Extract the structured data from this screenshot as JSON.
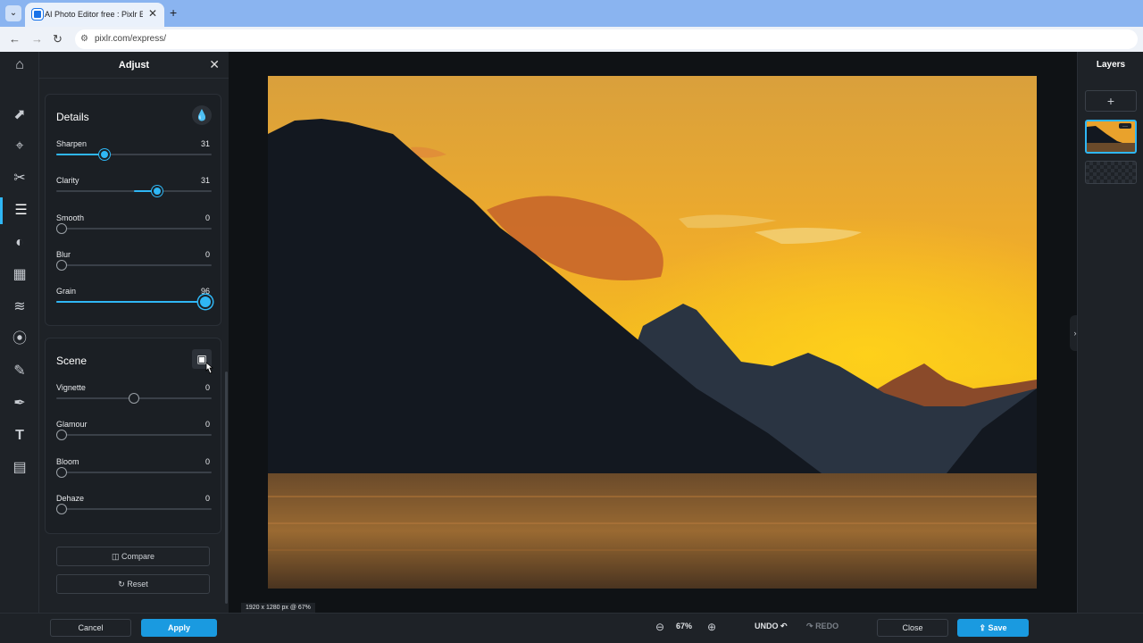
{
  "browser": {
    "tab_title": "AI Photo Editor free : Pixlr Express",
    "new_tab": "+",
    "url": "pixlr.com/express/"
  },
  "rail": {
    "icons": [
      "home-icon",
      "select-icon",
      "crop-icon",
      "cutout-icon",
      "adjust-icon",
      "filter-icon",
      "effect-icon",
      "liquify-icon",
      "swirl-icon",
      "retouch-icon",
      "draw-icon",
      "text-icon",
      "pattern-icon"
    ]
  },
  "panel": {
    "title": "Adjust",
    "details": {
      "title": "Details",
      "sliders": [
        {
          "label": "Sharpen",
          "value": "31",
          "level": 0.31
        },
        {
          "label": "Clarity",
          "value": "31",
          "level": 0.65
        },
        {
          "label": "Smooth",
          "value": "0",
          "level": 0
        },
        {
          "label": "Blur",
          "value": "0",
          "level": 0
        },
        {
          "label": "Grain",
          "value": "96",
          "level": 0.96
        }
      ]
    },
    "scene": {
      "title": "Scene",
      "sliders": [
        {
          "label": "Vignette",
          "value": "0",
          "level": 0.5
        },
        {
          "label": "Glamour",
          "value": "0",
          "level": 0
        },
        {
          "label": "Bloom",
          "value": "0",
          "level": 0
        },
        {
          "label": "Dehaze",
          "value": "0",
          "level": 0
        }
      ]
    },
    "compare": "Compare",
    "reset": "Reset"
  },
  "canvas": {
    "dimensions": "1920 x 1280 px @ 67%"
  },
  "layers": {
    "title": "Layers",
    "add": "+"
  },
  "bottom": {
    "cancel": "Cancel",
    "apply": "Apply",
    "zoom": "67%",
    "undo": "UNDO",
    "redo": "REDO",
    "close": "Close",
    "save": "Save"
  },
  "colors": {
    "accent": "#2fb7f5",
    "button_primary": "#1a9ae0",
    "background": "#1e2227"
  }
}
